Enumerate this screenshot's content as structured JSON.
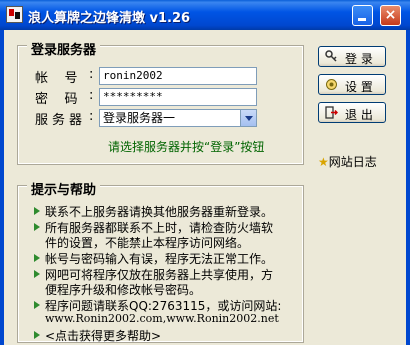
{
  "window": {
    "title": "浪人算牌之边锋清墩 v1.26",
    "close_glyph": "×"
  },
  "login": {
    "group_title": "登录服务器",
    "account_label": "帐    号",
    "account_value": "ronin2002",
    "password_label": "密    码",
    "password_value": "*********",
    "server_label": "服务器",
    "server_value": "登录服务器一",
    "colon": ":",
    "hint": "请选择服务器并按“登录”按钮"
  },
  "buttons": {
    "login": "登 录",
    "settings": "设 置",
    "exit": "退 出",
    "site_log": "网站日志"
  },
  "help": {
    "group_title": "提示与帮助",
    "lines": [
      "联系不上服务器请换其他服务器重新登录。",
      "所有服务器都联系不上时，请检查防火墙软",
      "件的设置，不能禁止本程序访问网络。",
      "帐号与密码输入有误，程序无法正常工作。",
      "网吧可将程序仅放在服务器上共享使用，方",
      "便程序升级和修改帐号密码。",
      "程序问题请联系QQ:2763115，或访问网站:",
      "www.Ronin2002.com,www.Ronin2002.net",
      "<点击获得更多帮助>"
    ]
  },
  "colors": {
    "titlebar": "#0055e5",
    "hint_text": "#006400",
    "bullet": "#2e8b2e"
  }
}
